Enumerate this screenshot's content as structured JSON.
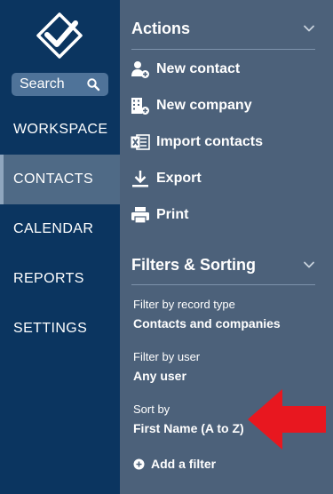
{
  "sidebar": {
    "search_label": "Search",
    "items": [
      {
        "label": "WORKSPACE"
      },
      {
        "label": "CONTACTS"
      },
      {
        "label": "CALENDAR"
      },
      {
        "label": "REPORTS"
      },
      {
        "label": "SETTINGS"
      }
    ],
    "active_item": "CONTACTS"
  },
  "panel": {
    "actions": {
      "title": "Actions",
      "items": [
        {
          "label": "New contact",
          "icon": "add-user-icon"
        },
        {
          "label": "New company",
          "icon": "add-company-icon"
        },
        {
          "label": "Import contacts",
          "icon": "excel-import-icon"
        },
        {
          "label": "Export",
          "icon": "download-icon"
        },
        {
          "label": "Print",
          "icon": "printer-icon"
        }
      ]
    },
    "filters": {
      "title": "Filters & Sorting",
      "record_type_label": "Filter by record type",
      "record_type_value": "Contacts and companies",
      "user_label": "Filter by user",
      "user_value": "Any user",
      "sort_label": "Sort by",
      "sort_value": "First Name (A to Z)",
      "add_filter_label": "Add a filter"
    }
  },
  "colors": {
    "sidebar_bg": "#0b3560",
    "panel_bg": "#4c617a",
    "active_nav_bg": "#4f6a86",
    "search_bg": "#4f7399",
    "arrow": "#e8171f"
  }
}
